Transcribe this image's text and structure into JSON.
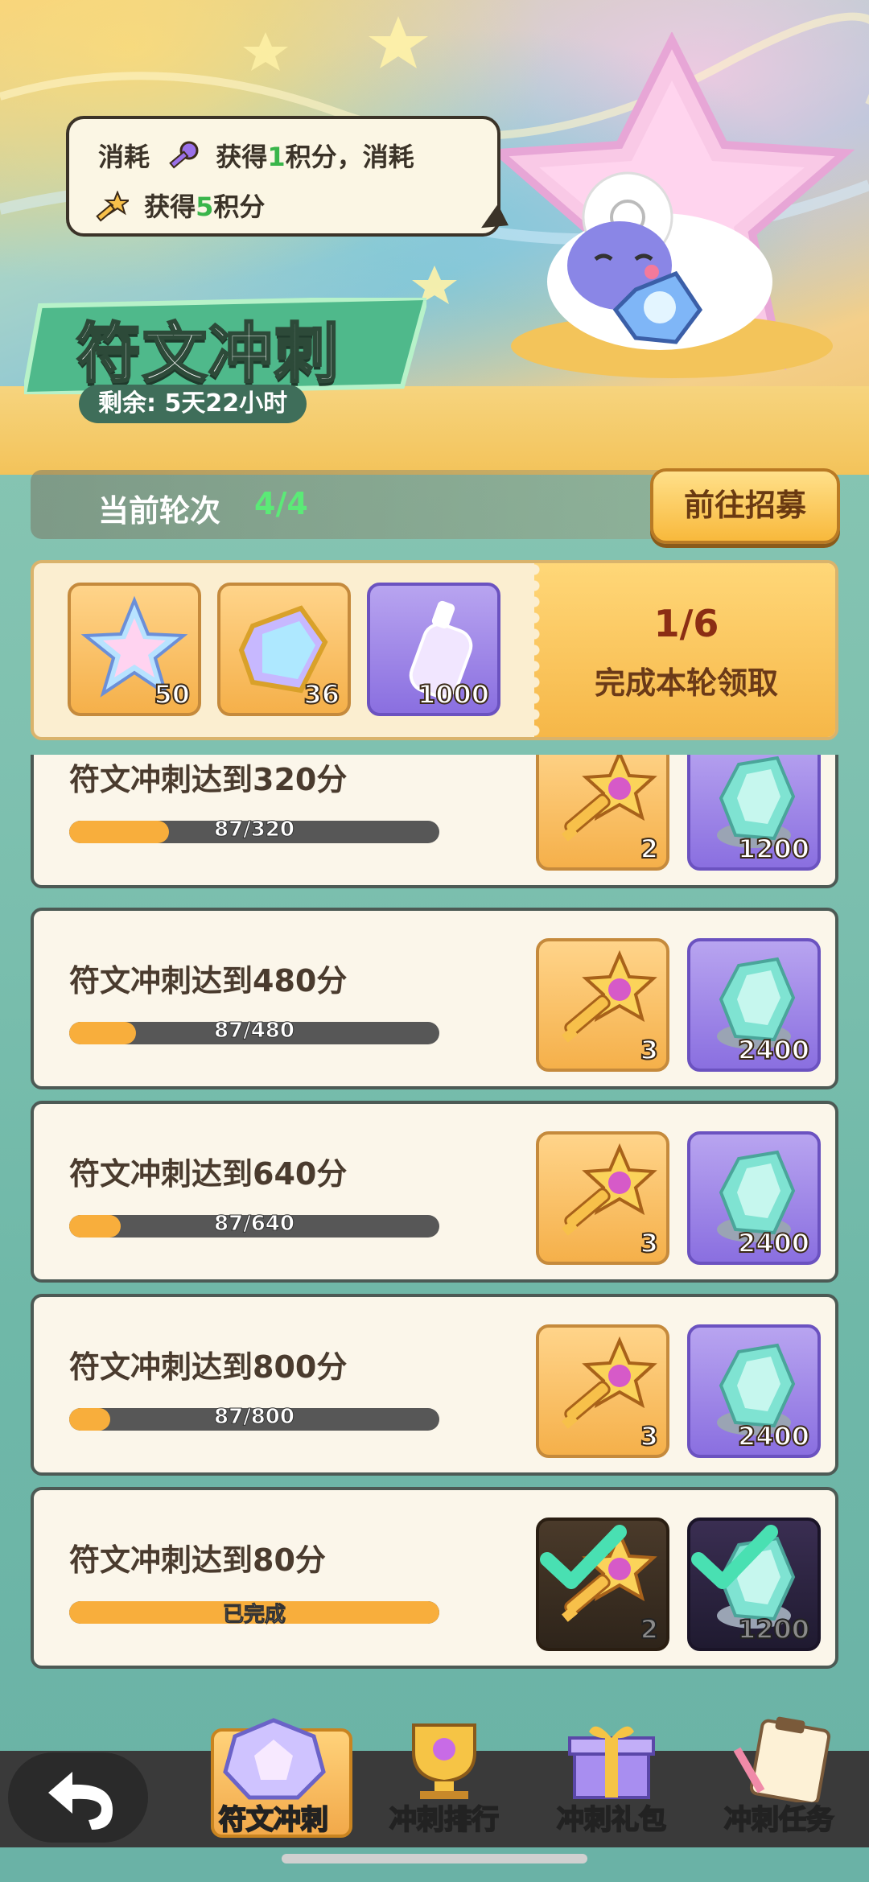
{
  "event": {
    "title": "符文冲刺",
    "remaining": "剩余: 5天22小时",
    "tip_line1_a": "消耗",
    "tip_line1_b": "获得",
    "tip_line1_c": "1",
    "tip_line1_d": "积分，消耗",
    "tip_line2_a": "获得",
    "tip_line2_b": "5",
    "tip_line2_c": "积分"
  },
  "round": {
    "label": "当前轮次",
    "value": "4/4",
    "go_button": "前往招募"
  },
  "round_reward": {
    "items": [
      {
        "icon": "rainbow-star-icon",
        "count": "50"
      },
      {
        "icon": "rainbow-cube-icon",
        "count": "36"
      },
      {
        "icon": "rainbow-bottle-icon",
        "count": "1000"
      }
    ],
    "progress": "1/6",
    "desc": "完成本轮领取"
  },
  "tasks": [
    {
      "title": "符文冲刺达到320分",
      "progress_text": "87/320",
      "progress": 0.27,
      "rewards": [
        {
          "icon": "star-key-icon",
          "count": "2"
        },
        {
          "icon": "crystal-icon",
          "count": "1200"
        }
      ],
      "done": false
    },
    {
      "title": "符文冲刺达到480分",
      "progress_text": "87/480",
      "progress": 0.18,
      "rewards": [
        {
          "icon": "star-key-icon",
          "count": "3"
        },
        {
          "icon": "crystal-icon",
          "count": "2400"
        }
      ],
      "done": false
    },
    {
      "title": "符文冲刺达到640分",
      "progress_text": "87/640",
      "progress": 0.14,
      "rewards": [
        {
          "icon": "star-key-icon",
          "count": "3"
        },
        {
          "icon": "crystal-icon",
          "count": "2400"
        }
      ],
      "done": false
    },
    {
      "title": "符文冲刺达到800分",
      "progress_text": "87/800",
      "progress": 0.11,
      "rewards": [
        {
          "icon": "star-key-icon",
          "count": "3"
        },
        {
          "icon": "crystal-icon",
          "count": "2400"
        }
      ],
      "done": false
    },
    {
      "title": "符文冲刺达到80分",
      "progress_text": "已完成",
      "progress": 1.0,
      "rewards": [
        {
          "icon": "star-key-icon",
          "count": "2"
        },
        {
          "icon": "crystal-icon",
          "count": "1200"
        }
      ],
      "done": true
    }
  ],
  "tabs": [
    {
      "label": "符文冲刺",
      "icon": "gem-icon",
      "active": true
    },
    {
      "label": "冲刺排行",
      "icon": "trophy-icon",
      "active": false
    },
    {
      "label": "冲刺礼包",
      "icon": "gift-icon",
      "active": false
    },
    {
      "label": "冲刺任务",
      "icon": "clipboard-icon",
      "active": false
    }
  ]
}
